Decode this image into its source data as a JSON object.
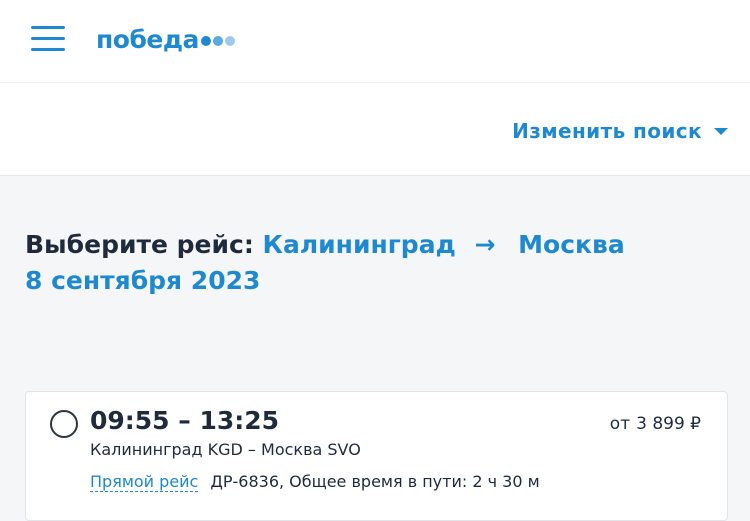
{
  "header": {
    "logo_text": "победа",
    "logo_dot_colors": [
      "#1e88d1",
      "#5aa8e0",
      "#9ccbef"
    ]
  },
  "search": {
    "change_label": "Изменить поиск"
  },
  "title": {
    "prefix": "Выберите рейс:",
    "origin": "Калининград",
    "arrow": "→",
    "destination": "Москва",
    "date": "8 сентября 2023"
  },
  "flights": [
    {
      "times": "09:55 – 13:25",
      "price_prefix": "от",
      "price": "3 899 ₽",
      "route": "Калининград KGD – Москва SVO",
      "type_label": "Прямой рейс",
      "details": "ДР-6836, Общее время в пути: 2 ч 30 м"
    }
  ],
  "colors": {
    "accent": "#1e88d1",
    "text": "#1f2b3d",
    "page_bg": "#f5f6f8"
  }
}
